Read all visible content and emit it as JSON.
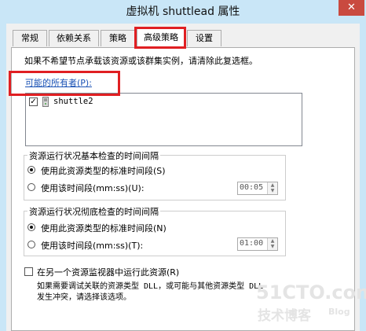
{
  "window": {
    "title": "虚拟机 shuttlead 属性",
    "close_glyph": "✕"
  },
  "tabs": [
    {
      "label": "常规",
      "active": false
    },
    {
      "label": "依赖关系",
      "active": false
    },
    {
      "label": "策略",
      "active": false
    },
    {
      "label": "高级策略",
      "active": true
    },
    {
      "label": "设置",
      "active": false
    }
  ],
  "advanced": {
    "instruction": "如果不希望节点承载该资源或该群集实例，请清除此复选框。",
    "possible_owners_label": "可能的所有者(P):",
    "owners": [
      {
        "name": "shuttle2",
        "checked": true
      }
    ],
    "basic_check": {
      "legend": "资源运行状况基本检查的时间间隔",
      "option_standard": "使用此资源类型的标准时间段(S)",
      "option_custom": "使用该时间段(mm:ss)(U):",
      "selected": "standard",
      "value": "00:05"
    },
    "thorough_check": {
      "legend": "资源运行状况彻底检查的时间间隔",
      "option_standard": "使用此资源类型的标准时间段(N)",
      "option_custom": "使用该时间段(mm:ss)(T):",
      "selected": "standard",
      "value": "01:00"
    },
    "separate_monitor": {
      "label": "在另一个资源监视器中运行此资源(R)",
      "checked": false,
      "description_line1": "如果需要调试关联的资源类型 DLL，或可能与其他资源类型 DLL",
      "description_line2": "发生冲突，请选择该选项。"
    }
  },
  "watermark": {
    "site": "51CTO.com",
    "line2": "技术博客",
    "line3": "Blog"
  },
  "colors": {
    "highlight": "#e01f22",
    "titlebar": "#c9e6f7",
    "close": "#c94a3f",
    "link": "#1a52b5"
  }
}
